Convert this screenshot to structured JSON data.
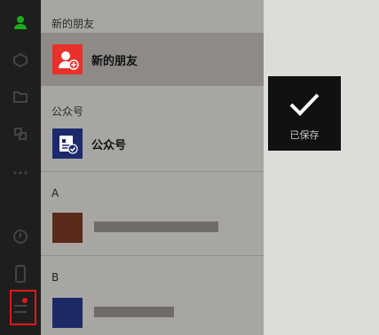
{
  "contacts_panel": {
    "sections": {
      "new_friends_header": "新的朋友",
      "new_friends_item": "新的朋友",
      "official_accounts_header": "公众号",
      "official_accounts_item": "公众号"
    },
    "letters": {
      "a": "A",
      "b": "B"
    }
  },
  "toast": {
    "message": "已保存",
    "icon": "checkmark-icon"
  },
  "sidebar": {
    "icons": [
      "user-icon",
      "cube-icon",
      "folder-icon",
      "link-icon",
      "more-dots-icon",
      "location-icon",
      "phone-icon",
      "more-menu-icon"
    ]
  },
  "colors": {
    "accent_green": "#1aad19",
    "avatar_red": "#e8312a",
    "avatar_navy": "#1c2a6d",
    "highlight_red": "#e01818"
  }
}
